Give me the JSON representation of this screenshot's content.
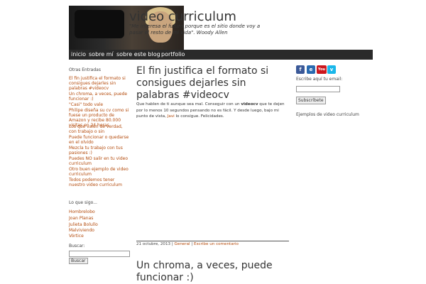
{
  "header": {
    "title": "video curriculum",
    "description": "\"Me interesa el futuro porque es el sitio donde voy a pasar el resto de mi vida\". Woody Allen"
  },
  "nav": {
    "items": [
      {
        "label": "inicio"
      },
      {
        "label": "sobre mí"
      },
      {
        "label": "sobre este blog"
      },
      {
        "label": "portfolio"
      }
    ]
  },
  "sidebar_left": {
    "recent_title": "Otras Entradas",
    "recent_items": [
      "El fin justifica el formato si consigues dejarles sin palabras #videocv",
      "Un chroma, a veces, puede funcionar :)",
      "\"Casi\" todo vale",
      "Philipe diseña su cv como si fuese un producto de Amazon y recibe 80.000 visitas en 24 horas",
      "Los que valen de verdad, con trabajo o sin",
      "Puede funcionar o quedarse en el olvido",
      "Mezcla tu trabajo con tus pasiones :)",
      "Puedes NO salir en tu video curriculum",
      "Otro buen ejemplo de video curriculum",
      "Todos podemos tener nuestro video curriculum"
    ],
    "follow_title": "Lo que sigo...",
    "follow_items": [
      "Hombrelobo",
      "Joan Planas",
      "Julieta Bolullo",
      "Malviviendo",
      "Vórtice"
    ],
    "search_label": "Buscar:",
    "search_button": "Buscar"
  },
  "post": {
    "title": "El fin justifica el formato si consigues dejarles sin palabras #videocv",
    "body_1": "Que hablen de ti aunque sea mal. Conseguir con un ",
    "body_bold": "videocv",
    "body_2": " que te dejen por lo menos 10 segundos pensando no es fácil. Y desde luego, bajo mi punto de vista, ",
    "body_link": "Javi",
    "body_3": " lo consigue. Felicidades.",
    "date": "21 octubre, 2013",
    "sep1": " | ",
    "category": "General",
    "sep2": " | ",
    "comment_link": "Escribe un comentario"
  },
  "post2": {
    "title": "Un chroma, a veces, puede funcionar :)"
  },
  "sidebar_right": {
    "social": [
      {
        "icon": "facebook-icon",
        "glyph": "f",
        "color": "#3b5998"
      },
      {
        "icon": "blogger-icon",
        "glyph": "e",
        "color": "#2a6bb0"
      },
      {
        "icon": "youtube-icon",
        "glyph": "You",
        "color": "#cc181e"
      },
      {
        "icon": "vimeo-icon",
        "glyph": "v",
        "color": "#1ab7ea"
      }
    ],
    "email_label": "Escribe aquí tu email:",
    "subscribe_button": "Subscríbete",
    "link": "Ejemplos de video curriculum"
  }
}
